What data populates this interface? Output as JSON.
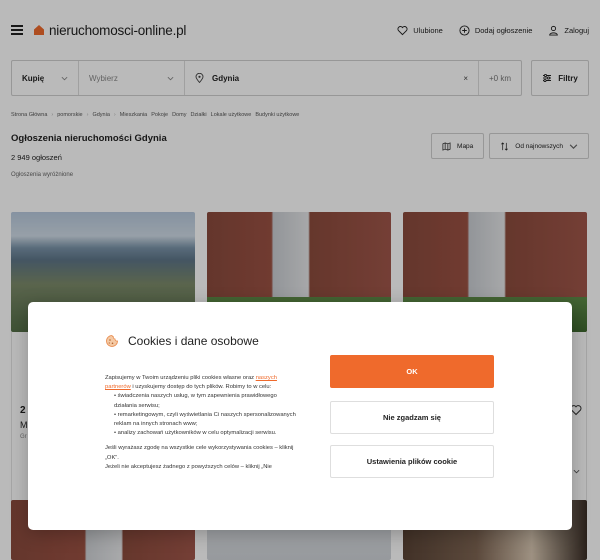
{
  "header": {
    "logo_text": "nieruchomosci-online.pl",
    "actions": [
      {
        "label": "Ulubione",
        "icon": "heart-icon"
      },
      {
        "label": "Dodaj ogłoszenie",
        "icon": "plus-circle-icon"
      },
      {
        "label": "Zaloguj",
        "icon": "user-icon"
      }
    ]
  },
  "search": {
    "kind": "Kupię",
    "type_placeholder": "Wybierz",
    "location": "Gdynia",
    "clear": "×",
    "radius": "+0 km",
    "filters_label": "Filtry"
  },
  "breadcrumb": [
    "Strona Główna",
    "pomorskie",
    "Gdynia",
    "Mieszkania",
    "Pokoje",
    "Domy",
    "Działki",
    "Lokale użytkowe",
    "Budynki użytkowe"
  ],
  "listing": {
    "title": "Ogłoszenia nieruchomości Gdynia",
    "count": "2 949 ogłoszeń",
    "map_label": "Mapa",
    "sort_label": "Od najnowszych",
    "featured_label": "Ogłoszenia wyróżnione"
  },
  "peek": {
    "price": "2",
    "area": "M",
    "location": "Gr"
  },
  "cookie_modal": {
    "title": "Cookies i dane osobowe",
    "intro_before": "Zapisujemy w Twoim urządzeniu pliki cookies własne oraz ",
    "intro_link": "naszych partnerów",
    "intro_after": " i uzyskujemy dostęp do tych plików. Robimy to w celu:",
    "purposes": [
      "świadczenia naszych usług, w tym zapewnienia prawidłowego działania serwisu;",
      "remarketingowym, czyli wyświetlania Ci naszych spersonalizowanych reklam na innych stronach www;",
      "analizy zachowań użytkowników w celu optymalizacji serwisu."
    ],
    "consent_text": "Jeśli wyrażasz zgodę na wszystkie cele wykorzystywania cookies – kliknij „OK”.",
    "reject_text": "Jeżeli nie akceptujesz żadnego z powyższych celów – kliknij „Nie",
    "ok_label": "OK",
    "reject_label": "Nie zgadzam się",
    "settings_label": "Ustawienia plików cookie"
  },
  "colors": {
    "accent": "#ef6a2c"
  }
}
